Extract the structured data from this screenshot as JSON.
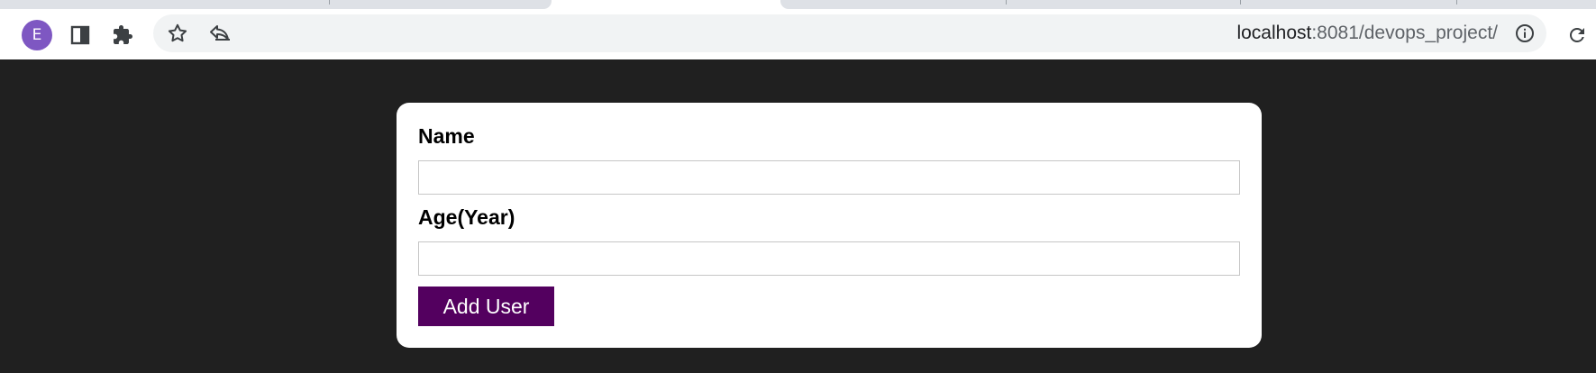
{
  "browser": {
    "profile_initial": "E",
    "url_host": "localhost",
    "url_rest": ":8081/devops_project/",
    "avatar_color": "#7e57c2",
    "icons": [
      "profile-avatar",
      "side-panel-icon",
      "extensions-icon",
      "star-icon",
      "share-icon",
      "site-info-icon",
      "reload-icon"
    ]
  },
  "form": {
    "name_label": "Name",
    "name_value": "",
    "age_label": "Age(Year)",
    "age_value": "",
    "submit_label": "Add User",
    "submit_color": "#53005f"
  }
}
